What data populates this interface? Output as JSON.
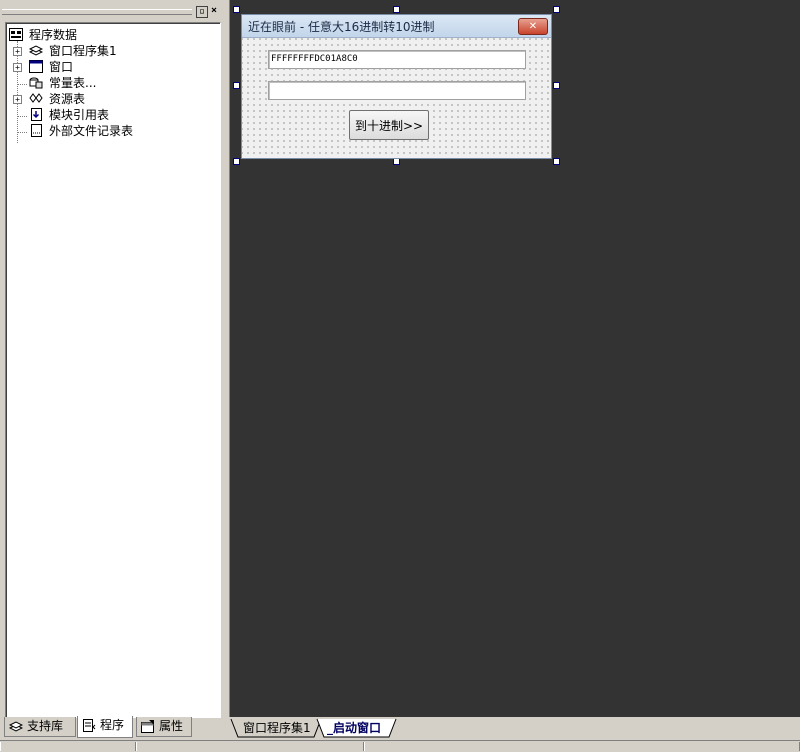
{
  "left_panel": {
    "controls": {
      "restore_symbol": "▫",
      "close_symbol": "×"
    },
    "tree": {
      "root": {
        "label": "程序数据",
        "icon": "program-data-icon"
      },
      "items": [
        {
          "label": "窗口程序集1",
          "icon": "layers-icon",
          "expandable": true
        },
        {
          "label": "窗口",
          "icon": "window-icon",
          "expandable": true
        },
        {
          "label": "常量表...",
          "icon": "constants-icon",
          "expandable": false
        },
        {
          "label": "资源表",
          "icon": "resources-icon",
          "expandable": true
        },
        {
          "label": "模块引用表",
          "icon": "module-ref-icon",
          "expandable": false
        },
        {
          "label": "外部文件记录表",
          "icon": "external-file-icon",
          "expandable": false
        }
      ]
    },
    "tabs": [
      {
        "label": "支持库",
        "icon": "library-icon",
        "active": false
      },
      {
        "label": "程序",
        "icon": "program-icon",
        "active": true
      },
      {
        "label": "属性",
        "icon": "properties-icon",
        "active": false
      }
    ]
  },
  "form": {
    "title": "近在眼前 - 任意大16进制转10进制",
    "close_symbol": "✕",
    "hex_input_value": "FFFFFFFFDC01A8C0",
    "dec_output_value": "",
    "convert_button_label": "到十进制>>"
  },
  "editor_tabs": [
    {
      "label": "窗口程序集1",
      "active": false
    },
    {
      "label": "_启动窗口",
      "active": true
    }
  ],
  "colors": {
    "design_background": "#333333",
    "panel_background": "#d4d0c8",
    "handle_border": "#000080"
  }
}
